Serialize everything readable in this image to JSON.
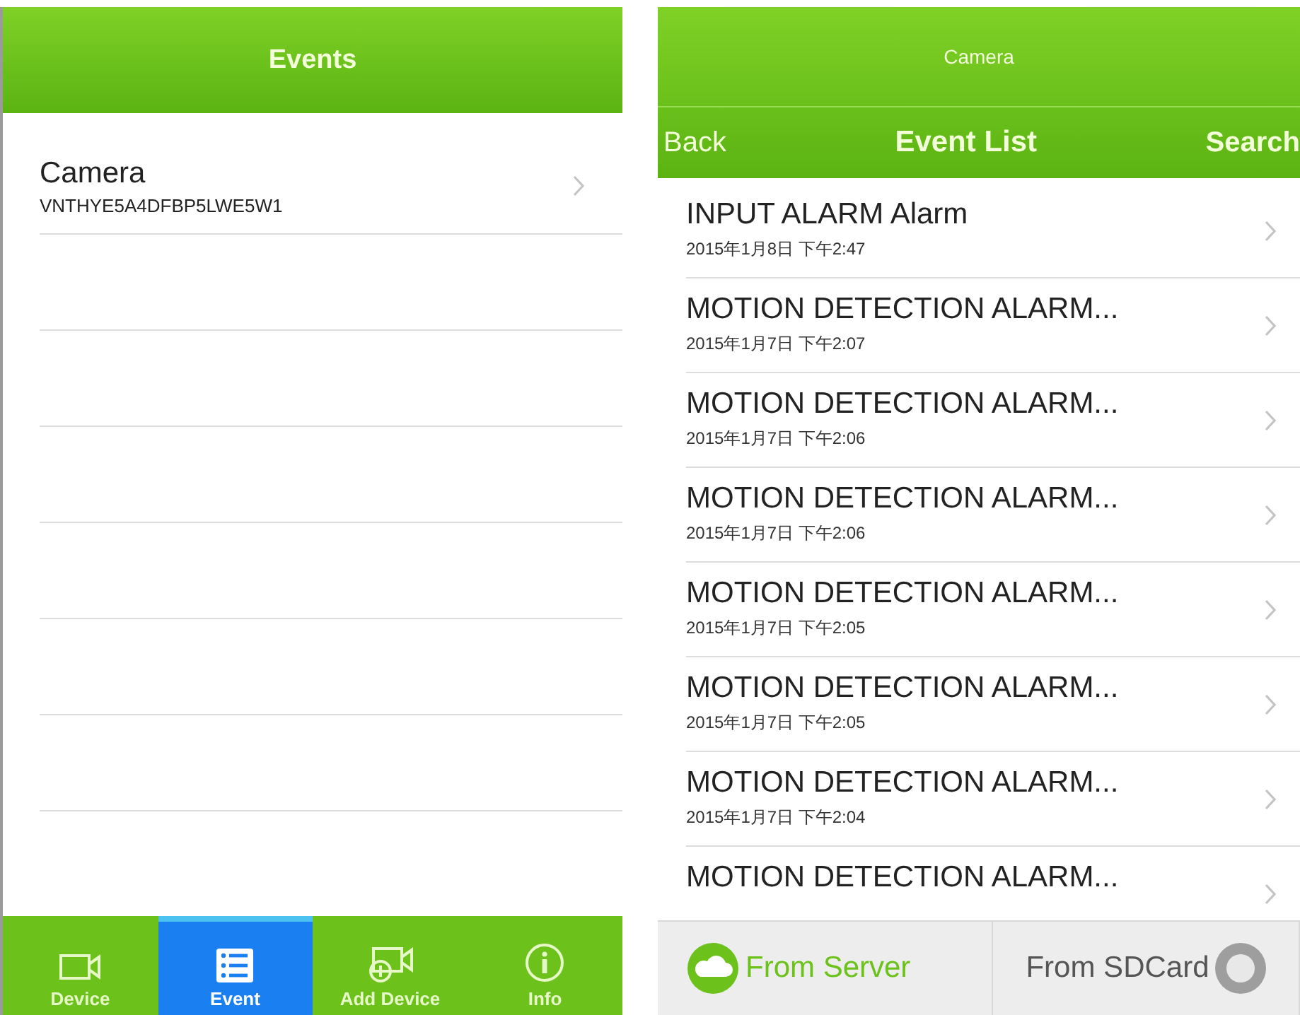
{
  "events_screen": {
    "title": "Events",
    "devices": [
      {
        "name": "Camera",
        "serial": "VNTHYE5A4DFBP5LWE5W1"
      }
    ],
    "tab_bar": [
      {
        "label": "Device",
        "selected": false
      },
      {
        "label": "Event",
        "selected": true
      },
      {
        "label": "Add Device",
        "selected": false
      },
      {
        "label": "Info",
        "selected": false
      }
    ]
  },
  "event_list_screen": {
    "device_title": "Camera",
    "back": "Back",
    "title": "Event List",
    "search": "Search",
    "events": [
      {
        "title": "INPUT ALARM Alarm",
        "date": "2015年1月8日 下午2:47"
      },
      {
        "title": "MOTION DETECTION ALARM...",
        "date": "2015年1月7日 下午2:07"
      },
      {
        "title": "MOTION DETECTION ALARM...",
        "date": "2015年1月7日 下午2:06"
      },
      {
        "title": "MOTION DETECTION ALARM...",
        "date": "2015年1月7日 下午2:06"
      },
      {
        "title": "MOTION DETECTION ALARM...",
        "date": "2015年1月7日 下午2:05"
      },
      {
        "title": "MOTION DETECTION ALARM...",
        "date": "2015年1月7日 下午2:05"
      },
      {
        "title": "MOTION DETECTION ALARM...",
        "date": "2015年1月7日 下午2:04"
      },
      {
        "title": "MOTION DETECTION ALARM..."
      }
    ],
    "sources": [
      {
        "label": "From Server",
        "selected": true
      },
      {
        "label": "From SDCard",
        "selected": false
      }
    ]
  }
}
